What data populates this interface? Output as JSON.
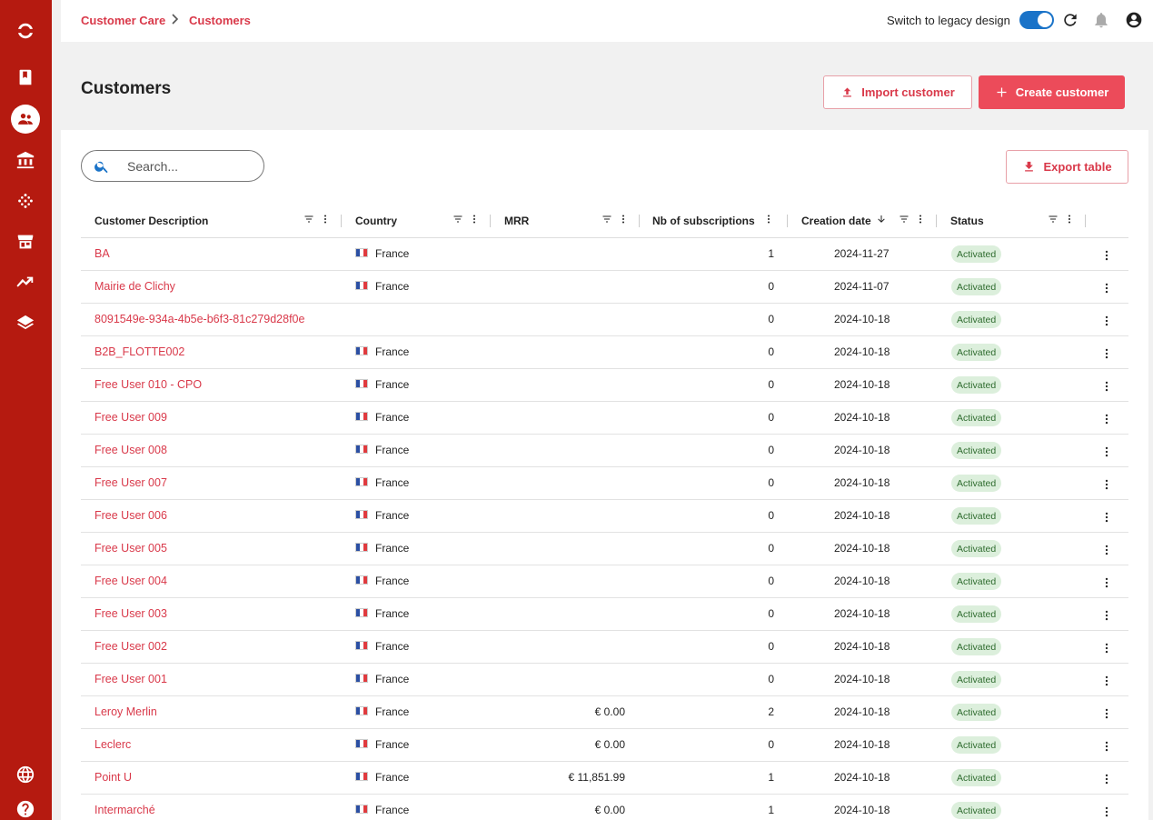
{
  "breadcrumb": {
    "items": [
      "Customer Care",
      "Customers"
    ]
  },
  "topbar": {
    "legacy_label": "Switch to legacy design",
    "legacy_toggle_on": true
  },
  "page": {
    "title": "Customers"
  },
  "actions": {
    "import_label": "Import customer",
    "create_label": "Create customer",
    "export_label": "Export table"
  },
  "search": {
    "placeholder": "Search...",
    "value": ""
  },
  "table": {
    "columns": [
      "Customer Description",
      "Country",
      "MRR",
      "Nb of subscriptions",
      "Creation date",
      "Status"
    ],
    "rows": [
      {
        "name": "BA",
        "country": "France",
        "mrr": "",
        "subs": "1",
        "date": "2024-11-27",
        "status": "Activated"
      },
      {
        "name": "Mairie de Clichy",
        "country": "France",
        "mrr": "",
        "subs": "0",
        "date": "2024-11-07",
        "status": "Activated"
      },
      {
        "name": "8091549e-934a-4b5e-b6f3-81c279d28f0e",
        "country": "",
        "mrr": "",
        "subs": "0",
        "date": "2024-10-18",
        "status": "Activated"
      },
      {
        "name": "B2B_FLOTTE002",
        "country": "France",
        "mrr": "",
        "subs": "0",
        "date": "2024-10-18",
        "status": "Activated"
      },
      {
        "name": "Free User 010 - CPO",
        "country": "France",
        "mrr": "",
        "subs": "0",
        "date": "2024-10-18",
        "status": "Activated"
      },
      {
        "name": "Free User 009",
        "country": "France",
        "mrr": "",
        "subs": "0",
        "date": "2024-10-18",
        "status": "Activated"
      },
      {
        "name": "Free User 008",
        "country": "France",
        "mrr": "",
        "subs": "0",
        "date": "2024-10-18",
        "status": "Activated"
      },
      {
        "name": "Free User 007",
        "country": "France",
        "mrr": "",
        "subs": "0",
        "date": "2024-10-18",
        "status": "Activated"
      },
      {
        "name": "Free User 006",
        "country": "France",
        "mrr": "",
        "subs": "0",
        "date": "2024-10-18",
        "status": "Activated"
      },
      {
        "name": "Free User 005",
        "country": "France",
        "mrr": "",
        "subs": "0",
        "date": "2024-10-18",
        "status": "Activated"
      },
      {
        "name": "Free User 004",
        "country": "France",
        "mrr": "",
        "subs": "0",
        "date": "2024-10-18",
        "status": "Activated"
      },
      {
        "name": "Free User 003",
        "country": "France",
        "mrr": "",
        "subs": "0",
        "date": "2024-10-18",
        "status": "Activated"
      },
      {
        "name": "Free User 002",
        "country": "France",
        "mrr": "",
        "subs": "0",
        "date": "2024-10-18",
        "status": "Activated"
      },
      {
        "name": "Free User 001",
        "country": "France",
        "mrr": "",
        "subs": "0",
        "date": "2024-10-18",
        "status": "Activated"
      },
      {
        "name": "Leroy Merlin",
        "country": "France",
        "mrr": "€ 0.00",
        "subs": "2",
        "date": "2024-10-18",
        "status": "Activated"
      },
      {
        "name": "Leclerc",
        "country": "France",
        "mrr": "€ 0.00",
        "subs": "0",
        "date": "2024-10-18",
        "status": "Activated"
      },
      {
        "name": "Point U",
        "country": "France",
        "mrr": "€ 11,851.99",
        "subs": "1",
        "date": "2024-10-18",
        "status": "Activated"
      },
      {
        "name": "Intermarché",
        "country": "France",
        "mrr": "€ 0.00",
        "subs": "1",
        "date": "2024-10-18",
        "status": "Activated"
      }
    ]
  },
  "colors": {
    "brand": "#b51a10",
    "accent": "#ec4b5a",
    "link": "#d9394a",
    "toggle": "#1a73c8",
    "badge_bg": "#dcefdc"
  },
  "icons": {
    "sidebar": [
      "logo-icon",
      "book-icon",
      "customers-icon",
      "bank-icon",
      "dots-grid-icon",
      "store-icon",
      "trending-up-icon",
      "layers-icon",
      "globe-icon",
      "help-icon"
    ],
    "top": [
      "refresh-icon",
      "bell-icon",
      "account-icon"
    ]
  }
}
